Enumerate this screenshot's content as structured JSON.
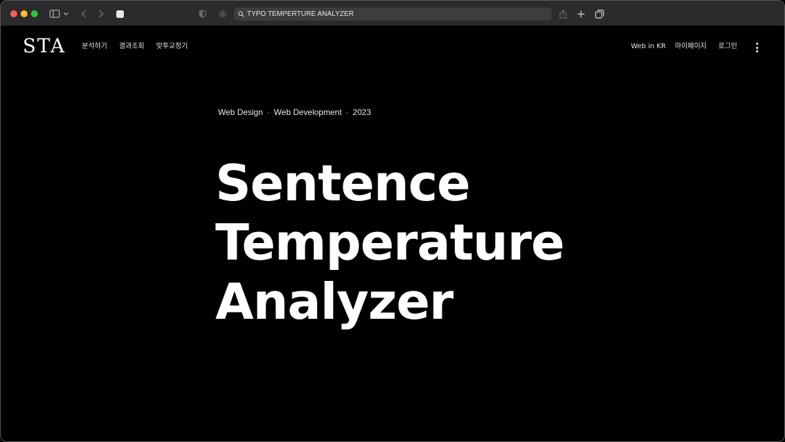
{
  "browser": {
    "url": "TYPO TEMPERTURE ANALYZER",
    "icons": {
      "sidebar": "sidebar-icon",
      "back": "chevron-left-icon",
      "forward": "chevron-right-icon",
      "share": "share-icon",
      "new_tab": "plus-icon",
      "tabs": "tab-overview-icon"
    }
  },
  "site": {
    "logo": "STA",
    "nav_left": [
      "분석하기",
      "결과조회",
      "맞투교정기"
    ],
    "nav_right": [
      "Web in KR",
      "마이페이지",
      "로그인"
    ]
  },
  "hero": {
    "meta": [
      "Web Design",
      "Web Development",
      "2023"
    ],
    "separator": "·",
    "title_lines": [
      "Sentence",
      "Temperature",
      "Analyzer"
    ]
  },
  "colors": {
    "background": "#000000",
    "toolbar": "#2b2b2d",
    "text": "#ffffff"
  }
}
